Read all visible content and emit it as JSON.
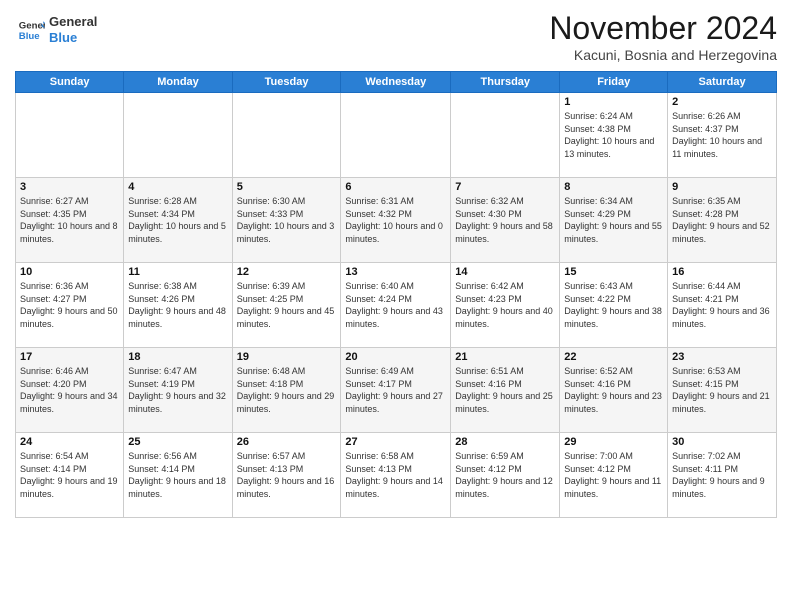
{
  "header": {
    "logo_line1": "General",
    "logo_line2": "Blue",
    "title": "November 2024",
    "subtitle": "Kacuni, Bosnia and Herzegovina"
  },
  "weekdays": [
    "Sunday",
    "Monday",
    "Tuesday",
    "Wednesday",
    "Thursday",
    "Friday",
    "Saturday"
  ],
  "weeks": [
    [
      {
        "day": "",
        "info": ""
      },
      {
        "day": "",
        "info": ""
      },
      {
        "day": "",
        "info": ""
      },
      {
        "day": "",
        "info": ""
      },
      {
        "day": "",
        "info": ""
      },
      {
        "day": "1",
        "info": "Sunrise: 6:24 AM\nSunset: 4:38 PM\nDaylight: 10 hours and 13 minutes."
      },
      {
        "day": "2",
        "info": "Sunrise: 6:26 AM\nSunset: 4:37 PM\nDaylight: 10 hours and 11 minutes."
      }
    ],
    [
      {
        "day": "3",
        "info": "Sunrise: 6:27 AM\nSunset: 4:35 PM\nDaylight: 10 hours and 8 minutes."
      },
      {
        "day": "4",
        "info": "Sunrise: 6:28 AM\nSunset: 4:34 PM\nDaylight: 10 hours and 5 minutes."
      },
      {
        "day": "5",
        "info": "Sunrise: 6:30 AM\nSunset: 4:33 PM\nDaylight: 10 hours and 3 minutes."
      },
      {
        "day": "6",
        "info": "Sunrise: 6:31 AM\nSunset: 4:32 PM\nDaylight: 10 hours and 0 minutes."
      },
      {
        "day": "7",
        "info": "Sunrise: 6:32 AM\nSunset: 4:30 PM\nDaylight: 9 hours and 58 minutes."
      },
      {
        "day": "8",
        "info": "Sunrise: 6:34 AM\nSunset: 4:29 PM\nDaylight: 9 hours and 55 minutes."
      },
      {
        "day": "9",
        "info": "Sunrise: 6:35 AM\nSunset: 4:28 PM\nDaylight: 9 hours and 52 minutes."
      }
    ],
    [
      {
        "day": "10",
        "info": "Sunrise: 6:36 AM\nSunset: 4:27 PM\nDaylight: 9 hours and 50 minutes."
      },
      {
        "day": "11",
        "info": "Sunrise: 6:38 AM\nSunset: 4:26 PM\nDaylight: 9 hours and 48 minutes."
      },
      {
        "day": "12",
        "info": "Sunrise: 6:39 AM\nSunset: 4:25 PM\nDaylight: 9 hours and 45 minutes."
      },
      {
        "day": "13",
        "info": "Sunrise: 6:40 AM\nSunset: 4:24 PM\nDaylight: 9 hours and 43 minutes."
      },
      {
        "day": "14",
        "info": "Sunrise: 6:42 AM\nSunset: 4:23 PM\nDaylight: 9 hours and 40 minutes."
      },
      {
        "day": "15",
        "info": "Sunrise: 6:43 AM\nSunset: 4:22 PM\nDaylight: 9 hours and 38 minutes."
      },
      {
        "day": "16",
        "info": "Sunrise: 6:44 AM\nSunset: 4:21 PM\nDaylight: 9 hours and 36 minutes."
      }
    ],
    [
      {
        "day": "17",
        "info": "Sunrise: 6:46 AM\nSunset: 4:20 PM\nDaylight: 9 hours and 34 minutes."
      },
      {
        "day": "18",
        "info": "Sunrise: 6:47 AM\nSunset: 4:19 PM\nDaylight: 9 hours and 32 minutes."
      },
      {
        "day": "19",
        "info": "Sunrise: 6:48 AM\nSunset: 4:18 PM\nDaylight: 9 hours and 29 minutes."
      },
      {
        "day": "20",
        "info": "Sunrise: 6:49 AM\nSunset: 4:17 PM\nDaylight: 9 hours and 27 minutes."
      },
      {
        "day": "21",
        "info": "Sunrise: 6:51 AM\nSunset: 4:16 PM\nDaylight: 9 hours and 25 minutes."
      },
      {
        "day": "22",
        "info": "Sunrise: 6:52 AM\nSunset: 4:16 PM\nDaylight: 9 hours and 23 minutes."
      },
      {
        "day": "23",
        "info": "Sunrise: 6:53 AM\nSunset: 4:15 PM\nDaylight: 9 hours and 21 minutes."
      }
    ],
    [
      {
        "day": "24",
        "info": "Sunrise: 6:54 AM\nSunset: 4:14 PM\nDaylight: 9 hours and 19 minutes."
      },
      {
        "day": "25",
        "info": "Sunrise: 6:56 AM\nSunset: 4:14 PM\nDaylight: 9 hours and 18 minutes."
      },
      {
        "day": "26",
        "info": "Sunrise: 6:57 AM\nSunset: 4:13 PM\nDaylight: 9 hours and 16 minutes."
      },
      {
        "day": "27",
        "info": "Sunrise: 6:58 AM\nSunset: 4:13 PM\nDaylight: 9 hours and 14 minutes."
      },
      {
        "day": "28",
        "info": "Sunrise: 6:59 AM\nSunset: 4:12 PM\nDaylight: 9 hours and 12 minutes."
      },
      {
        "day": "29",
        "info": "Sunrise: 7:00 AM\nSunset: 4:12 PM\nDaylight: 9 hours and 11 minutes."
      },
      {
        "day": "30",
        "info": "Sunrise: 7:02 AM\nSunset: 4:11 PM\nDaylight: 9 hours and 9 minutes."
      }
    ]
  ]
}
